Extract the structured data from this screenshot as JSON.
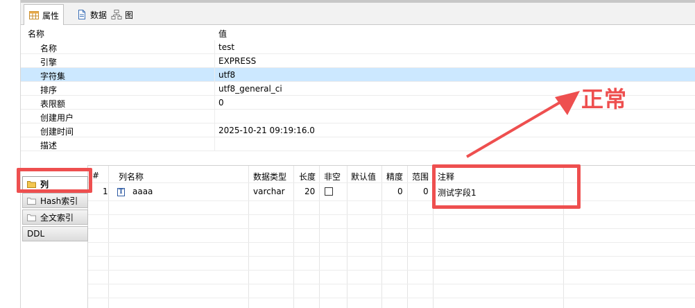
{
  "tabs": [
    {
      "label": "属性",
      "icon": "table-icon",
      "active": true
    },
    {
      "label": "数据",
      "icon": "document-icon",
      "active": false
    },
    {
      "label": "图",
      "icon": "diagram-icon",
      "active": false
    }
  ],
  "properties": {
    "header": {
      "name": "名称",
      "value": "值"
    },
    "rows": [
      {
        "key": "名称",
        "value": "test"
      },
      {
        "key": "引擎",
        "value": "EXPRESS"
      },
      {
        "key": "字符集",
        "value": "utf8",
        "selected": true
      },
      {
        "key": "排序",
        "value": "utf8_general_ci"
      },
      {
        "key": "表限额",
        "value": "0"
      },
      {
        "key": "创建用户",
        "value": ""
      },
      {
        "key": "创建时间",
        "value": "2025-10-21 09:19:16.0"
      },
      {
        "key": "描述",
        "value": ""
      }
    ]
  },
  "sidebar": {
    "items": [
      {
        "label": "列",
        "active": true
      },
      {
        "label": "Hash索引",
        "active": false
      },
      {
        "label": "全文索引",
        "active": false
      },
      {
        "label": "DDL",
        "active": false
      }
    ]
  },
  "columns_grid": {
    "headers": [
      "#",
      "列名称",
      "数据类型",
      "长度",
      "非空",
      "默认值",
      "精度",
      "范围",
      "注释"
    ],
    "rows": [
      {
        "index": "1",
        "name": "aaaa",
        "type": "varchar",
        "length": "20",
        "not_null": false,
        "default": "",
        "precision": "0",
        "scale": "0",
        "comment": "测试字段1"
      }
    ]
  },
  "annotation": {
    "text": "正常",
    "color": "#ee4f4f"
  },
  "colors": {
    "selected_row": "#cce8ff",
    "annotation": "#ee4f4f"
  }
}
